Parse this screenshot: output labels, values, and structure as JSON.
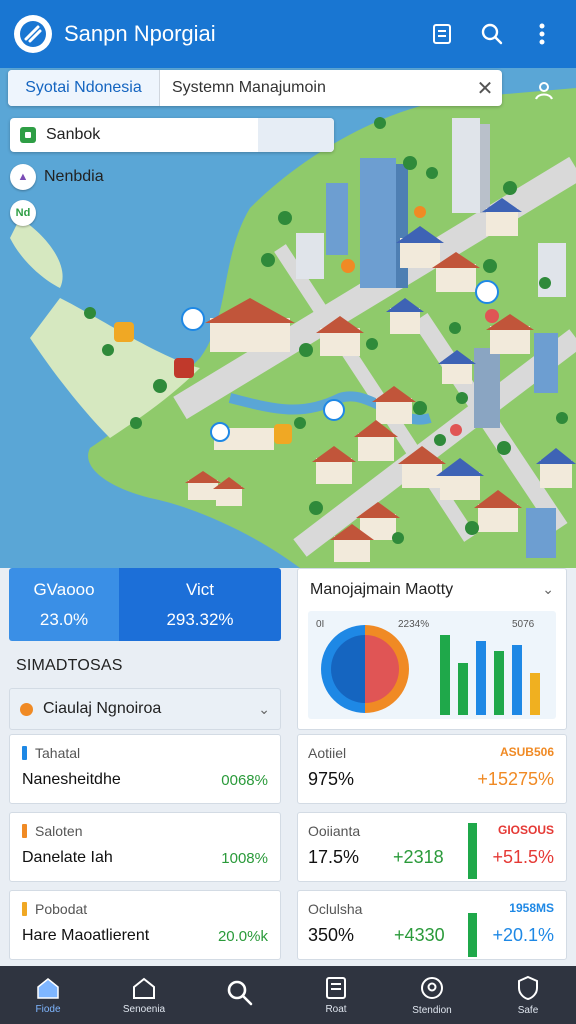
{
  "appbar": {
    "title": "Sanpn Nporgiai"
  },
  "search": {
    "region_tab": "Syotai Ndonesia",
    "value": "Systemn Manajumoin"
  },
  "layers": {
    "main_label": "Sanbok",
    "secondary_label": "Nenbdia",
    "tertiary_label": "Nd"
  },
  "stats": {
    "a_label": "GVaooo",
    "a_value": "23.0%",
    "b_label": "Vict",
    "b_value": "293.32%"
  },
  "section": {
    "title": "SIMADTOSAS"
  },
  "dropdown": {
    "label": "Ciaulaj Ngnoiroa"
  },
  "list": [
    {
      "category": "Tahatal",
      "name": "Nanesheitdhe",
      "value": "0068%",
      "color": "#1e88e5"
    },
    {
      "category": "Saloten",
      "name": "Danelate Iah",
      "value": "1008%",
      "color": "#f08a24"
    },
    {
      "category": "Pobodat",
      "name": "Hare Maoatlierent",
      "value": "20.0%k",
      "color": "#f0a824"
    }
  ],
  "chart_card": {
    "title": "Manojajmain Maotty",
    "labels": [
      "0I",
      "2234%",
      "5076"
    ],
    "bar_colors": [
      "#1fa84a",
      "#1fa84a",
      "#1e88e5",
      "#1fa84a",
      "#1e88e5",
      "#f0b020"
    ],
    "pie_colors": [
      "#1e88e5",
      "#f08a24",
      "#e05555"
    ]
  },
  "metrics": [
    {
      "label": "Aotiiel",
      "value": "975%",
      "right_label": "ASUB506",
      "delta": "+15275%",
      "delta_color": "#f08a24",
      "mid": ""
    },
    {
      "label": "Ooiianta",
      "value": "17.5%",
      "mid": "+2318",
      "right_label": "GIOSOUS",
      "delta": "+51.5%",
      "delta_color": "#e53935"
    },
    {
      "label": "Oclulsha",
      "value": "350%",
      "mid": "+4330",
      "right_label": "1958MS",
      "delta": "+20.1%",
      "delta_color": "#1e88e5"
    }
  ],
  "nav": [
    {
      "label": "Fiode",
      "icon": "home-icon"
    },
    {
      "label": "Senoenia",
      "icon": "house-outline-icon"
    },
    {
      "label": "",
      "icon": "search-icon"
    },
    {
      "label": "Roat",
      "icon": "report-icon"
    },
    {
      "label": "Stendion",
      "icon": "location-icon"
    },
    {
      "label": "Safe",
      "icon": "shield-icon"
    }
  ]
}
